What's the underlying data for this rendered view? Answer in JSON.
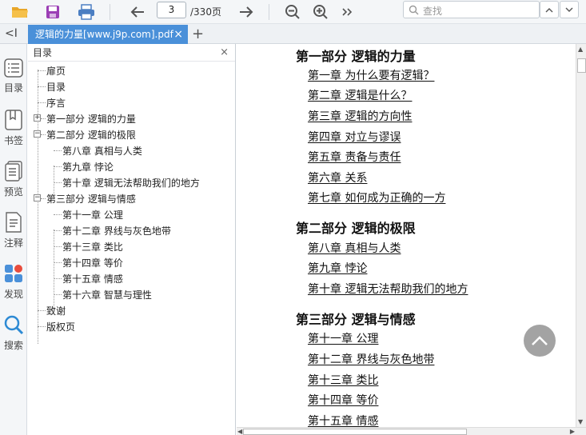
{
  "toolbar": {
    "page_current": "3",
    "page_total": "/330页",
    "search_placeholder": "查找"
  },
  "tab": {
    "title": "逻辑的力量[www.j9p.com].pdf",
    "close": "×",
    "add": "+"
  },
  "collapse_label": "<I",
  "rail": {
    "toc": "目录",
    "bookmarks": "书签",
    "preview": "预览",
    "notes": "注释",
    "discover": "发现",
    "search": "搜索"
  },
  "panel": {
    "title": "目录",
    "close": "×",
    "tree": {
      "n0": "扉页",
      "n1": "目录",
      "n2": "序言",
      "n3": "第一部分 逻辑的力量",
      "n4": "第二部分 逻辑的极限",
      "n5": "第八章 真相与人类",
      "n6": "第九章 悖论",
      "n7": "第十章 逻辑无法帮助我们的地方",
      "n8": "第三部分 逻辑与情感",
      "n9": "第十一章 公理",
      "n10": "第十二章 界线与灰色地带",
      "n11": "第十三章 类比",
      "n12": "第十四章 等价",
      "n13": "第十五章 情感",
      "n14": "第十六章 智慧与理性",
      "n15": "致谢",
      "n16": "版权页"
    },
    "expand_plus": "+",
    "expand_minus": "−"
  },
  "doc": {
    "part1": "第一部分 逻辑的力量",
    "c1": "第一章 为什么要有逻辑？",
    "c2": "第二章 逻辑是什么？",
    "c3": "第三章 逻辑的方向性",
    "c4": "第四章 对立与谬误",
    "c5": "第五章 责备与责任",
    "c6": "第六章 关系",
    "c7": "第七章 如何成为正确的一方",
    "part2": "第二部分 逻辑的极限",
    "c8": "第八章 真相与人类",
    "c9": "第九章 悖论",
    "c10": "第十章 逻辑无法帮助我们的地方",
    "part3": "第三部分 逻辑与情感",
    "c11": "第十一章 公理",
    "c12": "第十二章 界线与灰色地带",
    "c13": "第十三章 类比",
    "c14": "第十四章 等价",
    "c15": "第十五章 情感"
  },
  "colors": {
    "accent": "#4a90d9",
    "folder": "#e8a628",
    "save": "#9b3fb5",
    "print": "#4b7ec2"
  }
}
